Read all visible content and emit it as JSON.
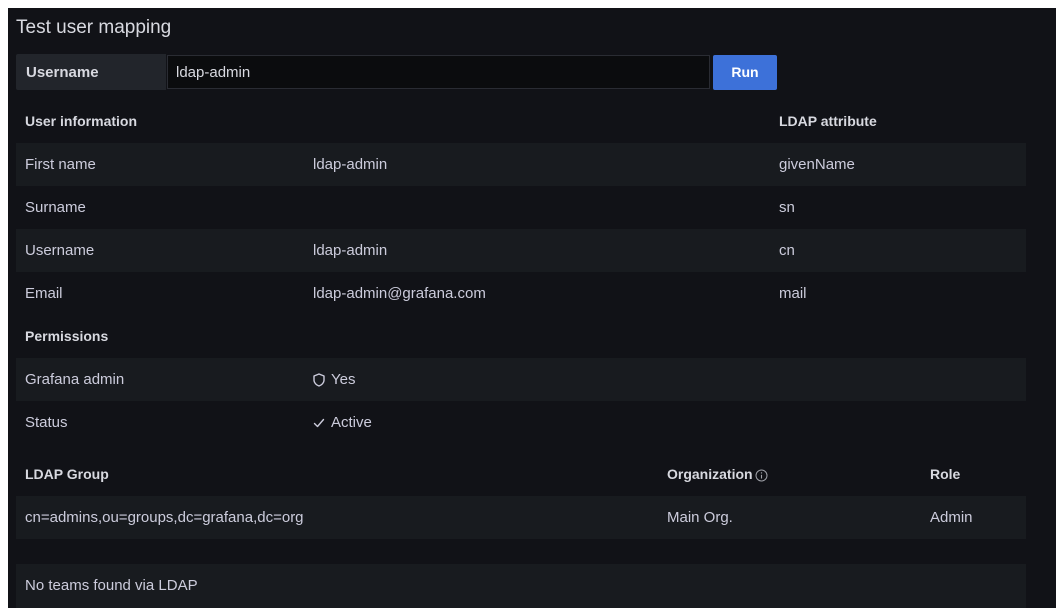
{
  "title": "Test user mapping",
  "search": {
    "label": "Username",
    "value": "ldap-admin",
    "run_label": "Run"
  },
  "user_info": {
    "header": "User information",
    "attr_header": "LDAP attribute",
    "rows": [
      {
        "label": "First name",
        "value": "ldap-admin",
        "attribute": "givenName"
      },
      {
        "label": "Surname",
        "value": "",
        "attribute": "sn"
      },
      {
        "label": "Username",
        "value": "ldap-admin",
        "attribute": "cn"
      },
      {
        "label": "Email",
        "value": "ldap-admin@grafana.com",
        "attribute": "mail"
      }
    ]
  },
  "permissions": {
    "header": "Permissions",
    "grafana_admin": {
      "label": "Grafana admin",
      "value": "Yes",
      "icon": "shield-icon"
    },
    "status": {
      "label": "Status",
      "value": "Active",
      "icon": "check-icon"
    }
  },
  "groups": {
    "header_group": "LDAP Group",
    "header_org": "Organization",
    "header_role": "Role",
    "rows": [
      {
        "group": "cn=admins,ou=groups,dc=grafana,dc=org",
        "org": "Main Org.",
        "role": "Admin"
      }
    ]
  },
  "teams": {
    "empty_text": "No teams found via LDAP"
  },
  "colors": {
    "background": "#111217",
    "row_stripe": "#181b1f",
    "primary_button": "#3d71d9",
    "text": "#ccccdc"
  }
}
